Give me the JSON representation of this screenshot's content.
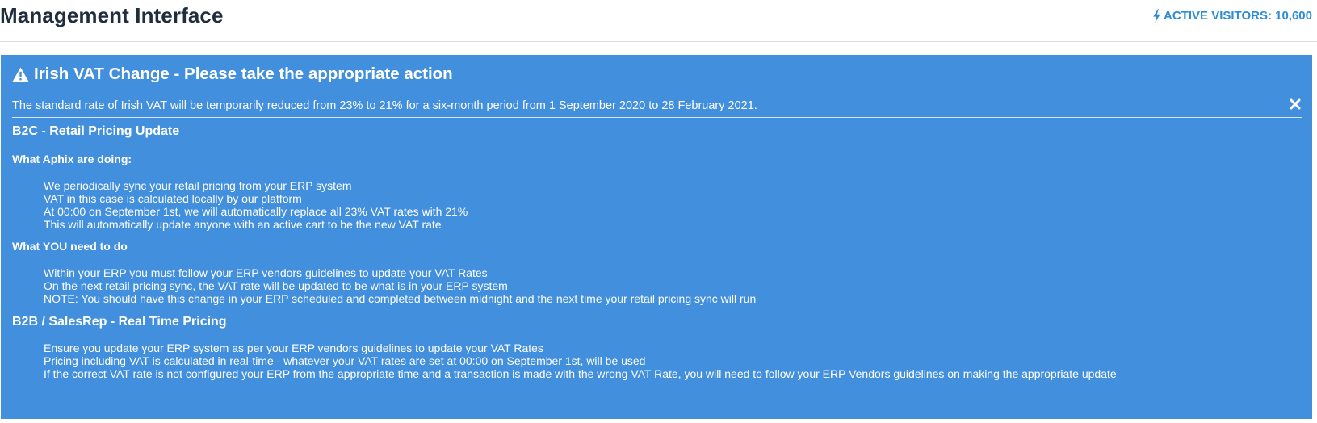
{
  "header": {
    "title": "Management Interface",
    "visitors_label": "ACTIVE VISITORS: 10,600"
  },
  "alert": {
    "title": "Irish VAT Change - Please take the appropriate action",
    "intro": "The standard rate of Irish VAT will be temporarily reduced from 23% to 21% for a six-month period from 1 September 2020 to 28 February 2021.",
    "b2c": {
      "heading": "B2C - Retail Pricing Update",
      "doing_heading": "What Aphix are doing:",
      "doing_items": [
        "We periodically sync your retail pricing from your ERP system",
        "VAT in this case is calculated locally by our platform",
        "At 00:00 on September 1st, we will automatically replace all 23% VAT rates with 21%",
        "This will automatically update anyone with an active cart to be the new VAT rate"
      ],
      "todo_heading": "What YOU need to do",
      "todo_items": [
        "Within your ERP you must follow your ERP vendors guidelines to update your VAT Rates",
        "On the next retail pricing sync, the VAT rate will be updated to be what is in your ERP system",
        "NOTE: You should have this change in your ERP scheduled and completed between midnight and the next time your retail pricing sync will run"
      ]
    },
    "b2b": {
      "heading": "B2B / SalesRep - Real Time Pricing",
      "items": [
        "Ensure you update your ERP system as per your ERP vendors guidelines to update your VAT Rates",
        "Pricing including VAT is calculated in real-time - whatever your VAT rates are set at 00:00 on September 1st, will be used",
        "If the correct VAT rate is not configured your ERP from the appropriate time and a transaction is made with the wrong VAT Rate, you will need to follow your ERP Vendors guidelines on making the appropriate update"
      ]
    }
  },
  "icons": {
    "visitors": "bolt-icon",
    "alert": "warning-icon",
    "close": "close-icon"
  },
  "colors": {
    "alert_background": "#428fde",
    "accent": "#2c8dd6",
    "title": "#1f2d3d"
  }
}
